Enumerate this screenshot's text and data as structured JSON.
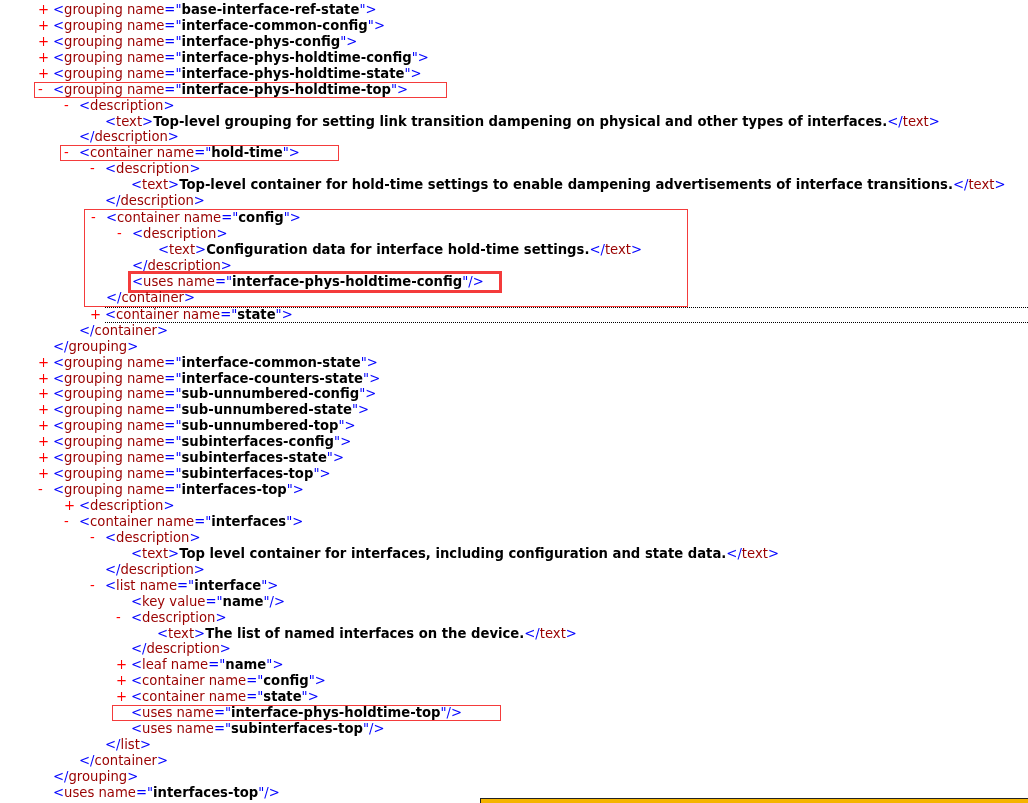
{
  "syntax": {
    "lt": "<",
    "gt": ">",
    "end_open": "</",
    "eq": "=",
    "quote": "\"",
    "self_close": "/>",
    "expand": "+",
    "collapse": "-"
  },
  "tree": [
    {
      "kind": "element",
      "tag": "grouping",
      "attr": "name",
      "value": "base-interface-ref-state",
      "expanded": false
    },
    {
      "kind": "element",
      "tag": "grouping",
      "attr": "name",
      "value": "interface-common-config",
      "expanded": false
    },
    {
      "kind": "element",
      "tag": "grouping",
      "attr": "name",
      "value": "interface-phys-config",
      "expanded": false
    },
    {
      "kind": "element",
      "tag": "grouping",
      "attr": "name",
      "value": "interface-phys-holdtime-config",
      "expanded": false
    },
    {
      "kind": "element",
      "tag": "grouping",
      "attr": "name",
      "value": "interface-phys-holdtime-state",
      "expanded": false
    },
    {
      "kind": "element",
      "tag": "grouping",
      "attr": "name",
      "value": "interface-phys-holdtime-top",
      "expanded": true,
      "highlighted": true,
      "close_tag": "grouping",
      "children": [
        {
          "kind": "element",
          "tag": "description",
          "expanded": true,
          "close_tag": "description",
          "children": [
            {
              "kind": "text",
              "tag": "text",
              "content": "Top-level grouping for setting link transition dampening on physical and other types of interfaces.",
              "close_tag": "text"
            }
          ]
        },
        {
          "kind": "element",
          "tag": "container",
          "attr": "name",
          "value": "hold-time",
          "expanded": true,
          "highlighted": true,
          "close_tag": "container",
          "children": [
            {
              "kind": "element",
              "tag": "description",
              "expanded": true,
              "close_tag": "description",
              "children": [
                {
                  "kind": "text",
                  "tag": "text",
                  "content": "Top-level container for hold-time settings to enable dampening advertisements of interface transitions.",
                  "close_tag": "text"
                }
              ]
            },
            {
              "kind": "element",
              "tag": "container",
              "attr": "name",
              "value": "config",
              "expanded": true,
              "highlighted": true,
              "frame_children": true,
              "close_tag": "container",
              "children": [
                {
                  "kind": "element",
                  "tag": "description",
                  "expanded": true,
                  "close_tag": "description",
                  "children": [
                    {
                      "kind": "text",
                      "tag": "text",
                      "content": "Configuration data for interface hold-time settings.",
                      "close_tag": "text"
                    }
                  ]
                },
                {
                  "kind": "empty",
                  "tag": "uses",
                  "attr": "name",
                  "value": "interface-phys-holdtime-config",
                  "highlighted": true,
                  "bold_frame": true
                }
              ]
            },
            {
              "kind": "element",
              "tag": "container",
              "attr": "name",
              "value": "state",
              "expanded": false,
              "focused": true
            }
          ]
        }
      ]
    },
    {
      "kind": "element",
      "tag": "grouping",
      "attr": "name",
      "value": "interface-common-state",
      "expanded": false
    },
    {
      "kind": "element",
      "tag": "grouping",
      "attr": "name",
      "value": "interface-counters-state",
      "expanded": false
    },
    {
      "kind": "element",
      "tag": "grouping",
      "attr": "name",
      "value": "sub-unnumbered-config",
      "expanded": false
    },
    {
      "kind": "element",
      "tag": "grouping",
      "attr": "name",
      "value": "sub-unnumbered-state",
      "expanded": false
    },
    {
      "kind": "element",
      "tag": "grouping",
      "attr": "name",
      "value": "sub-unnumbered-top",
      "expanded": false
    },
    {
      "kind": "element",
      "tag": "grouping",
      "attr": "name",
      "value": "subinterfaces-config",
      "expanded": false
    },
    {
      "kind": "element",
      "tag": "grouping",
      "attr": "name",
      "value": "subinterfaces-state",
      "expanded": false
    },
    {
      "kind": "element",
      "tag": "grouping",
      "attr": "name",
      "value": "subinterfaces-top",
      "expanded": false
    },
    {
      "kind": "element",
      "tag": "grouping",
      "attr": "name",
      "value": "interfaces-top",
      "expanded": true,
      "close_tag": "grouping",
      "children": [
        {
          "kind": "element",
          "tag": "description",
          "expanded": false
        },
        {
          "kind": "element",
          "tag": "container",
          "attr": "name",
          "value": "interfaces",
          "expanded": true,
          "close_tag": "container",
          "children": [
            {
              "kind": "element",
              "tag": "description",
              "expanded": true,
              "close_tag": "description",
              "children": [
                {
                  "kind": "text",
                  "tag": "text",
                  "content": "Top level container for interfaces, including configuration and state data.",
                  "close_tag": "text"
                }
              ]
            },
            {
              "kind": "element",
              "tag": "list",
              "attr": "name",
              "value": "interface",
              "expanded": true,
              "close_tag": "list",
              "children": [
                {
                  "kind": "empty",
                  "tag": "key",
                  "attr": "value",
                  "value": "name"
                },
                {
                  "kind": "element",
                  "tag": "description",
                  "expanded": true,
                  "close_tag": "description",
                  "children": [
                    {
                      "kind": "text",
                      "tag": "text",
                      "content": "The list of named interfaces on the device.",
                      "close_tag": "text"
                    }
                  ]
                },
                {
                  "kind": "element",
                  "tag": "leaf",
                  "attr": "name",
                  "value": "name",
                  "expanded": false
                },
                {
                  "kind": "element",
                  "tag": "container",
                  "attr": "name",
                  "value": "config",
                  "expanded": false
                },
                {
                  "kind": "element",
                  "tag": "container",
                  "attr": "name",
                  "value": "state",
                  "expanded": false
                },
                {
                  "kind": "empty",
                  "tag": "uses",
                  "attr": "name",
                  "value": "interface-phys-holdtime-top",
                  "highlighted": true
                },
                {
                  "kind": "empty",
                  "tag": "uses",
                  "attr": "name",
                  "value": "subinterfaces-top"
                }
              ]
            }
          ]
        }
      ]
    },
    {
      "kind": "empty",
      "tag": "uses",
      "attr": "name",
      "value": "interfaces-top"
    }
  ]
}
